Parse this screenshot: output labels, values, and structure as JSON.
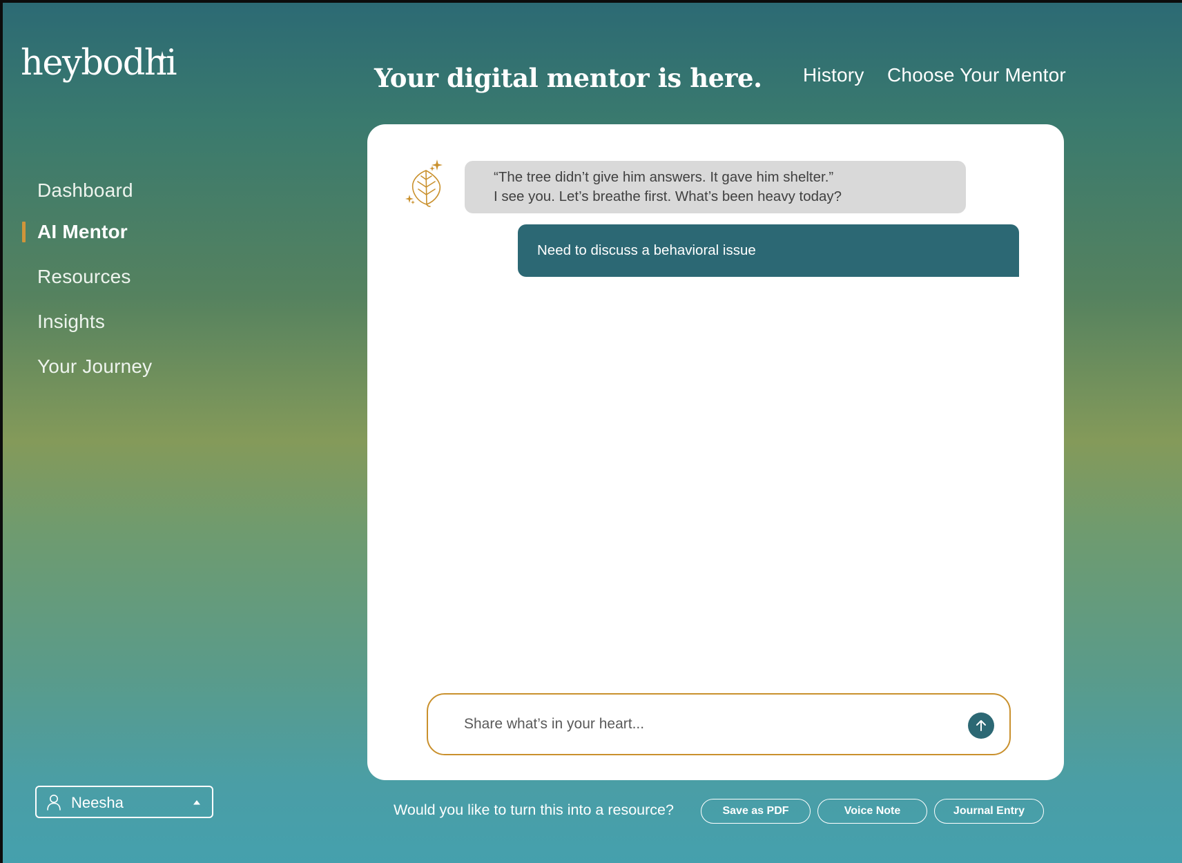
{
  "brand": {
    "name_prefix": "hey",
    "name_suffix": "bodhi",
    "sparkle_icon": "sparkle-icon"
  },
  "header": {
    "headline": "Your digital mentor is here.",
    "links": {
      "history": "History",
      "choose_mentor": "Choose Your Mentor"
    }
  },
  "sidebar": {
    "items": [
      {
        "label": "Dashboard",
        "active": false
      },
      {
        "label": "AI Mentor",
        "active": true
      },
      {
        "label": "Resources",
        "active": false
      },
      {
        "label": "Insights",
        "active": false
      },
      {
        "label": "Your Journey",
        "active": false
      }
    ],
    "accent_color": "#d0953a"
  },
  "chat": {
    "mentor_avatar_icon": "bodhi-leaf-icon",
    "messages": [
      {
        "role": "mentor",
        "lines": [
          "“The tree didn’t give him answers. It gave him shelter.”",
          "I see you. Let’s breathe first. What’s been heavy today?"
        ]
      },
      {
        "role": "user",
        "text": "Need to discuss a behavioral issue"
      }
    ],
    "composer": {
      "placeholder": "Share what’s in your heart...",
      "value": "",
      "send_icon": "arrow-up-icon"
    }
  },
  "resource_actions": {
    "prompt": "Would you like to turn this into a resource?",
    "buttons": {
      "pdf": "Save as PDF",
      "voice": "Voice Note",
      "journal": "Journal Entry"
    }
  },
  "user": {
    "name": "Neesha",
    "icon": "user-icon",
    "caret_icon": "caret-up-icon"
  },
  "colors": {
    "teal": "#2c6874",
    "gold": "#c9902c",
    "mentor_bubble": "#d9d9d9"
  }
}
